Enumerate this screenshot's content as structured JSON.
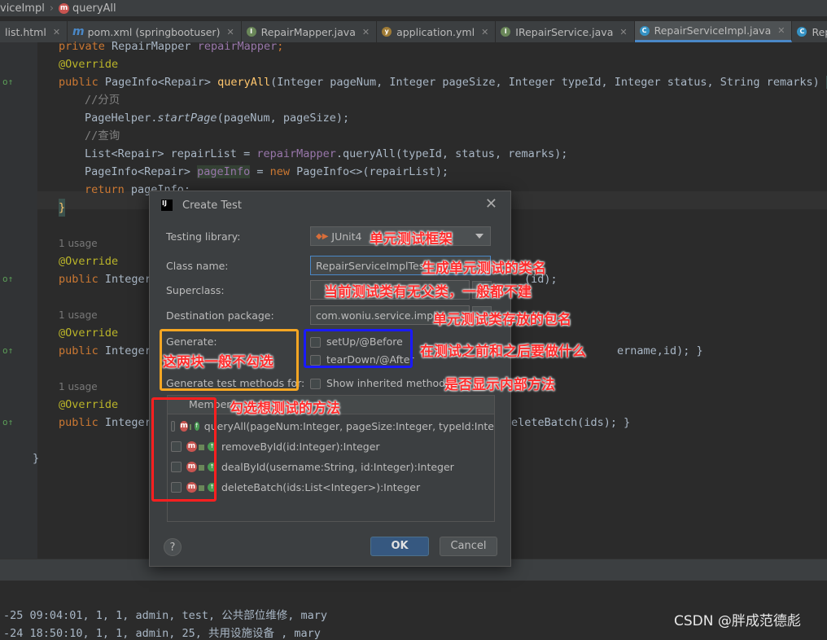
{
  "breadcrumb": {
    "class_name": "viceImpl",
    "method": "queryAll",
    "method_badge": "m"
  },
  "tabs": [
    {
      "label": "list.html",
      "icon": "html-file-icon",
      "active": false
    },
    {
      "label": "pom.xml (springbootuser)",
      "icon": "maven-icon",
      "active": false
    },
    {
      "label": "RepairMapper.java",
      "icon": "interface-icon",
      "active": false
    },
    {
      "label": "application.yml",
      "icon": "yaml-icon",
      "active": false
    },
    {
      "label": "IRepairService.java",
      "icon": "interface-icon",
      "active": false
    },
    {
      "label": "RepairServiceImpl.java",
      "icon": "class-icon",
      "active": true
    },
    {
      "label": "RepairContro",
      "icon": "class-icon",
      "active": false
    }
  ],
  "code": {
    "l1": {
      "kw": "private ",
      "type": "RepairMapper ",
      "field": "repairMapper",
      "end": ";"
    },
    "l2": "@Override",
    "l3": {
      "kw": "public ",
      "ret": "PageInfo<Repair> ",
      "fn": "queryAll",
      "params": "(Integer pageNum, Integer pageSize, Integer typeId, Integer status, String remarks) ",
      "brace": "{"
    },
    "l4": "//分页",
    "l5": {
      "obj": "PageHelper.",
      "call": "startPage",
      "args": "(pageNum, pageSize);"
    },
    "l6": "//查询",
    "l7": {
      "decl": "List<Repair> repairList = ",
      "field": "repairMapper",
      "rest": ".queryAll(typeId, status, remarks);"
    },
    "l8": {
      "decl": "PageInfo<Repair> ",
      "var": "pageInfo",
      "eq": " = ",
      "kw": "new ",
      "rest": "PageInfo<>(repairList);"
    },
    "l9": {
      "kw": "return ",
      "rest": "pageInfo;"
    },
    "l10": "}",
    "usage": "1 usage",
    "override": "@Override",
    "pub": "public ",
    "integer": "Integer",
    "frag_id": "(id);",
    "frag_name": "ername,id);",
    "frag_close": " }",
    "frag_batch": "eleteBatch(ids);",
    "class_close": "}"
  },
  "console": [
    "-25 09:04:01, 1, 1, admin, test, 公共部位维修, mary",
    "-24 18:50:10, 1, 1, admin, 25, 共用设施设备 , mary"
  ],
  "watermark": "CSDN @胖成范德彪",
  "dialog": {
    "title": "Create Test",
    "icon_text": "IJ",
    "testing_library_label": "Testing library:",
    "testing_library_value": "JUnit4",
    "class_name_label": "Class name:",
    "class_name_value": "RepairServiceImplTest",
    "superclass_label": "Superclass:",
    "superclass_value": "",
    "destination_label": "Destination package:",
    "destination_value": "com.woniu.service.impl",
    "generate_label": "Generate:",
    "setup_label": "setUp/@Before",
    "teardown_label": "tearDown/@After",
    "generate_methods_label": "Generate test methods for:",
    "show_inherited_label": "Show inherited methods",
    "members_header": "Member",
    "members": [
      "queryAll(pageNum:Integer, pageSize:Integer, typeId:Inte",
      "removeById(id:Integer):Integer",
      "dealById(username:String, id:Integer):Integer",
      "deleteBatch(ids:List<Integer>):Integer"
    ],
    "ok_label": "OK",
    "cancel_label": "Cancel",
    "help_label": "?"
  },
  "annotations": {
    "junit_framework": "单元测试框架",
    "class_name": "生成单元测试的类名",
    "superclass": "当前测试类有无父类，一般都不建",
    "package": "单元测试类存放的包名",
    "generate_hint": "这两块一般不勾选",
    "setup_teardown": "在测试之前和之后要做什么",
    "inherited": "是否显示内部方法",
    "methods": "勾选想测试的方法"
  },
  "colors": {
    "orange_box": "#f5a623",
    "blue_box": "#1a1aff",
    "red_box": "#ff1f1f",
    "annotation_text": "#ff2d2d",
    "ok_button": "#365880"
  }
}
